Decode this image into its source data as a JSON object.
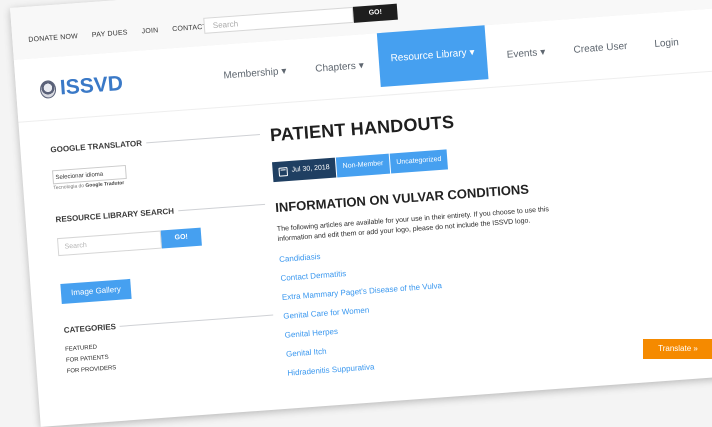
{
  "topbar": {
    "links": [
      "DONATE NOW",
      "PAY DUES",
      "JOIN",
      "CONTACT"
    ],
    "search_placeholder": "Search",
    "go_label": "GO!"
  },
  "brand": {
    "logo_text": "ISSVD"
  },
  "nav": {
    "membership": "Membership",
    "chapters": "Chapters",
    "resource_library": "Resource Library",
    "events": "Events",
    "create_user": "Create User",
    "login": "Login",
    "dropdown_chevron": "▾"
  },
  "sidebar": {
    "google_translator_title": "GOOGLE TRANSLATOR",
    "select_language": "Selecionar idioma",
    "tech_prefix": "Tecnologia do",
    "google_word": "Google",
    "tradutor_word": "Tradutor",
    "resource_search_title": "RESOURCE LIBRARY SEARCH",
    "search_placeholder": "Search",
    "go_label": "GO!",
    "gallery_label": "Image Gallery",
    "categories_title": "CATEGORIES",
    "categories": [
      "FEATURED",
      "FOR PATIENTS",
      "FOR PROVIDERS"
    ]
  },
  "main": {
    "page_title": "PATIENT HANDOUTS",
    "meta": {
      "date": "Jul 30, 2018",
      "audience": "Non-Member",
      "category": "Uncategorized"
    },
    "section_title": "INFORMATION ON VULVAR CONDITIONS",
    "intro_line1": "The following articles are available for your use in their entirety.  If you choose to use this",
    "intro_line2": "information and edit them or add your logo, please do not include the ISSVD logo.",
    "links": [
      "Candidiasis",
      "Contact Dermatitis",
      "Extra Mammary Paget's Disease of the Vulva",
      "Genital Care for Women",
      "Genital Herpes",
      "Genital Itch",
      "Hidradenitis Suppurativa"
    ]
  },
  "translate_widget": {
    "label": "Translate »"
  },
  "colors": {
    "accent_blue": "#46a0f0",
    "dark_navy": "#1f3f62",
    "orange": "#f58a00",
    "logo_blue": "#3a79c7"
  }
}
